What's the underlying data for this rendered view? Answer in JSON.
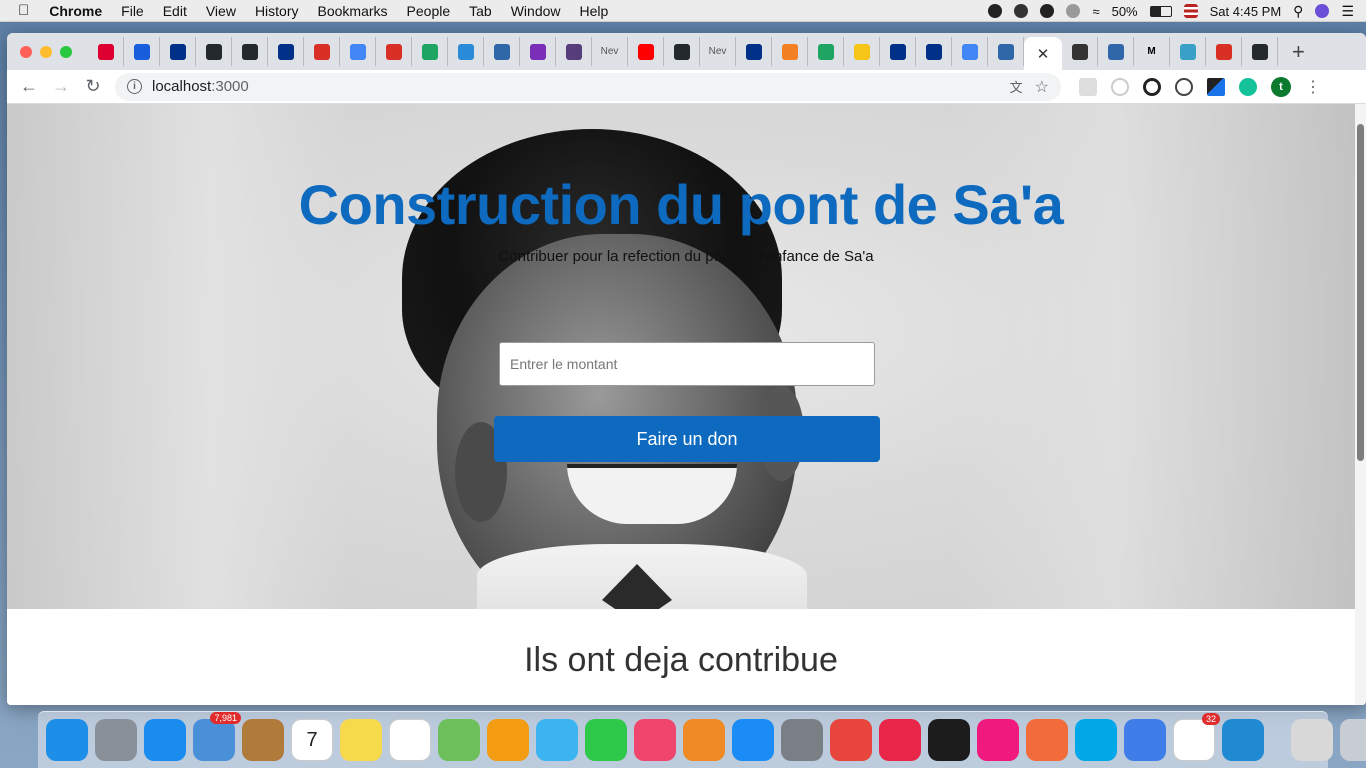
{
  "menubar": {
    "app_name": "Chrome",
    "items": [
      "File",
      "Edit",
      "View",
      "History",
      "Bookmarks",
      "People",
      "Tab",
      "Window",
      "Help"
    ],
    "battery": "50%",
    "clock": "Sat 4:45 PM"
  },
  "browser": {
    "tabs": [
      {
        "icon": "angular-icon",
        "color": "#dd0031"
      },
      {
        "icon": "bitwarden-icon",
        "color": "#175ddc"
      },
      {
        "icon": "paypal-icon",
        "color": "#003087"
      },
      {
        "icon": "github-icon",
        "color": "#24292e"
      },
      {
        "icon": "github-icon",
        "color": "#24292e"
      },
      {
        "icon": "paypal-icon",
        "color": "#003087"
      },
      {
        "icon": "gmail-icon",
        "color": "#d93025"
      },
      {
        "icon": "google-icon",
        "color": "#4285f4"
      },
      {
        "icon": "gmail-icon",
        "color": "#d93025"
      },
      {
        "icon": "drive-icon",
        "color": "#1fa463"
      },
      {
        "icon": "cube-icon",
        "color": "#2a8bd8"
      },
      {
        "icon": "pg-icon",
        "color": "#2f66a8"
      },
      {
        "icon": "circle-app-icon",
        "color": "#7b2fb8"
      },
      {
        "icon": "bootstrap-icon",
        "color": "#563d7c"
      },
      {
        "icon": "text-tab-icon",
        "color": "#888888",
        "label": "Nev"
      },
      {
        "icon": "youtube-icon",
        "color": "#ff0000"
      },
      {
        "icon": "github-icon",
        "color": "#24292e"
      },
      {
        "icon": "text-tab-icon",
        "color": "#888888",
        "label": "Nev"
      },
      {
        "icon": "paypal-icon",
        "color": "#003087"
      },
      {
        "icon": "stackoverflow-icon",
        "color": "#f48024"
      },
      {
        "icon": "drive-icon",
        "color": "#1fa463"
      },
      {
        "icon": "emoji-icon",
        "color": "#f5c518"
      },
      {
        "icon": "paypal-icon",
        "color": "#003087"
      },
      {
        "icon": "paypal-icon",
        "color": "#003087"
      },
      {
        "icon": "google-icon",
        "color": "#4285f4"
      },
      {
        "icon": "pg-icon",
        "color": "#2f66a8"
      }
    ],
    "tabs_after_active": [
      {
        "icon": "wave-icon",
        "color": "#333333"
      },
      {
        "icon": "pg-icon",
        "color": "#2f66a8"
      },
      {
        "icon": "medium-icon",
        "color": "#000000",
        "label": "M"
      },
      {
        "icon": "bird-icon",
        "color": "#3aa0c8"
      },
      {
        "icon": "gmail-icon",
        "color": "#d93025"
      },
      {
        "icon": "github-icon",
        "color": "#24292e"
      }
    ],
    "active_tab_close": "✕",
    "new_tab": "+",
    "url_host": "localhost",
    "url_port": ":3000",
    "profile_initial": "t"
  },
  "page": {
    "title": "Construction du pont de Sa'a",
    "subtitle": "Contribuer pour la refection du pont de l'enfance de Sa'a",
    "amount_placeholder": "Entrer le montant",
    "donate_label": "Faire un don",
    "contributors_heading": "Ils ont deja contribue"
  },
  "dock": {
    "apps": [
      {
        "name": "finder-icon",
        "color": "#1e8fe8"
      },
      {
        "name": "launchpad-icon",
        "color": "#8a9099"
      },
      {
        "name": "safari-icon",
        "color": "#1a8cf0"
      },
      {
        "name": "mail-icon",
        "color": "#4a90d9",
        "badge": "7,981"
      },
      {
        "name": "contacts-icon",
        "color": "#b07a3a"
      },
      {
        "name": "calendar-icon",
        "color": "#ffffff",
        "label": "7"
      },
      {
        "name": "notes-icon",
        "color": "#f7d94c"
      },
      {
        "name": "reminders-icon",
        "color": "#ffffff"
      },
      {
        "name": "maps-icon",
        "color": "#6cbf5a"
      },
      {
        "name": "photos-icon",
        "color": "#f39c12"
      },
      {
        "name": "messages-icon",
        "color": "#3cb4f2"
      },
      {
        "name": "facetime-icon",
        "color": "#2ec84b"
      },
      {
        "name": "music-icon",
        "color": "#f0466e"
      },
      {
        "name": "books-icon",
        "color": "#f08a24"
      },
      {
        "name": "appstore-icon",
        "color": "#1b8cf5"
      },
      {
        "name": "system-preferences-icon",
        "color": "#7a7f86"
      },
      {
        "name": "chrome-icon",
        "color": "#e8453c"
      },
      {
        "name": "player-icon",
        "color": "#e9254a"
      },
      {
        "name": "terminal-icon",
        "color": "#1c1c1c"
      },
      {
        "name": "pink-app-icon",
        "color": "#f0197e"
      },
      {
        "name": "postman-icon",
        "color": "#f26b3a"
      },
      {
        "name": "skype-icon",
        "color": "#00a8e8"
      },
      {
        "name": "chromium-icon",
        "color": "#3f7ee8"
      },
      {
        "name": "slack-icon",
        "color": "#ffffff",
        "badge": "32"
      },
      {
        "name": "vscode-icon",
        "color": "#1f8ad2"
      }
    ],
    "right": [
      {
        "name": "document-stack-icon",
        "color": "#d8d8d8"
      },
      {
        "name": "trash-icon",
        "color": "#c8cdd3"
      }
    ]
  }
}
